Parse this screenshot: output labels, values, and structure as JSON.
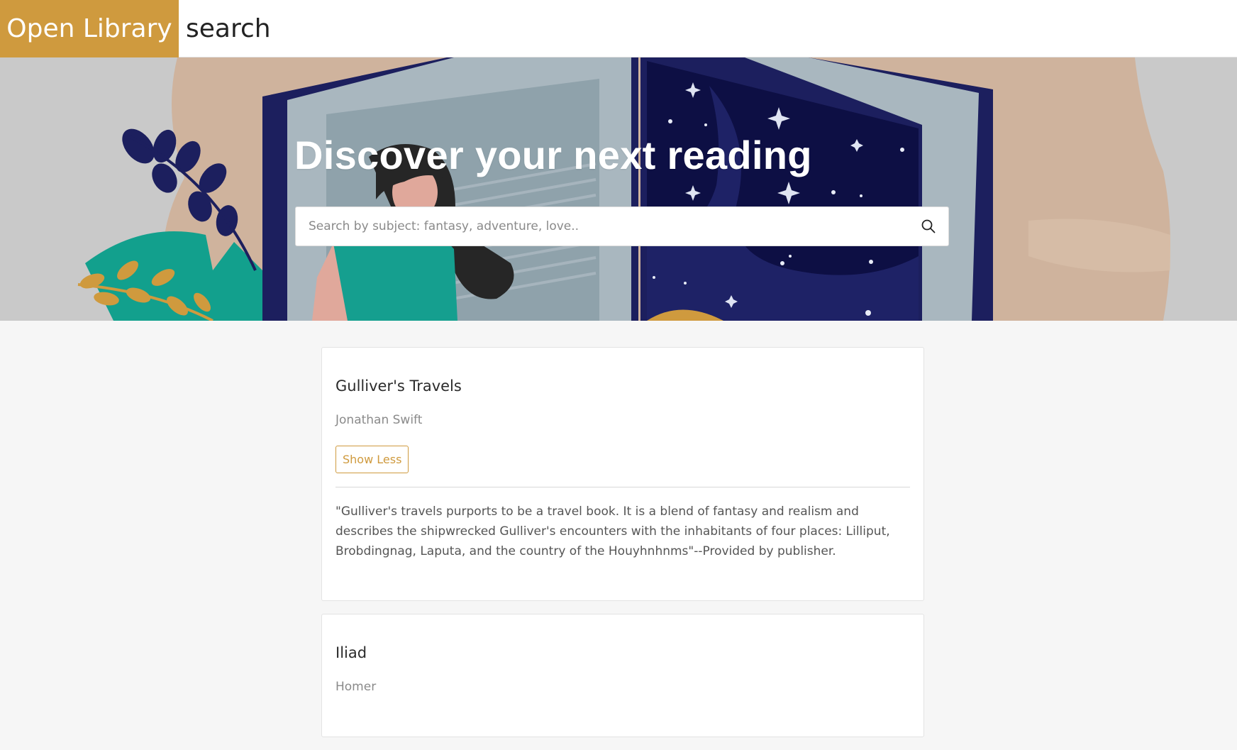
{
  "header": {
    "brand": "Open Library",
    "title": "search"
  },
  "hero": {
    "heading": "Discover your next reading",
    "search": {
      "placeholder": "Search by subject: fantasy, adventure, love..",
      "value": ""
    }
  },
  "results": [
    {
      "title": "Gulliver's Travels",
      "author": "Jonathan Swift",
      "toggle_label": "Show Less",
      "description": "\"Gulliver's travels purports to be a travel book. It is a blend of fantasy and realism and describes the shipwrecked Gulliver's encounters with the inhabitants of four places: Lilliput, Brobdingnag, Laputa, and the country of the Houyhnhnms\"--Provided by publisher."
    },
    {
      "title": "Iliad",
      "author": "Homer"
    }
  ],
  "colors": {
    "brand": "#cf9a3e",
    "page_background": "#f6f6f6",
    "book_navy": "#1c1f5e"
  },
  "icons": {
    "search": "magnifier"
  }
}
